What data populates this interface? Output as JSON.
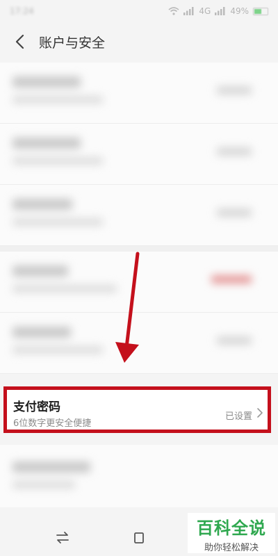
{
  "status_bar": {
    "time": "17:24",
    "network": "4G",
    "battery": "49%"
  },
  "header": {
    "title": "账户与安全"
  },
  "payment_password": {
    "title": "支付密码",
    "subtitle": "6位数字更安全便捷",
    "status": "已设置"
  },
  "watermark": {
    "title": "百科全说",
    "subtitle": "助你轻松解决"
  },
  "colors": {
    "highlight": "#c4101c",
    "watermark_green": "#2fa84f"
  },
  "icons": {
    "back": "chevron-left-icon",
    "row_chevron": "chevron-right-icon",
    "nav_switch": "switch-arrows-icon",
    "nav_recent": "square-icon"
  }
}
